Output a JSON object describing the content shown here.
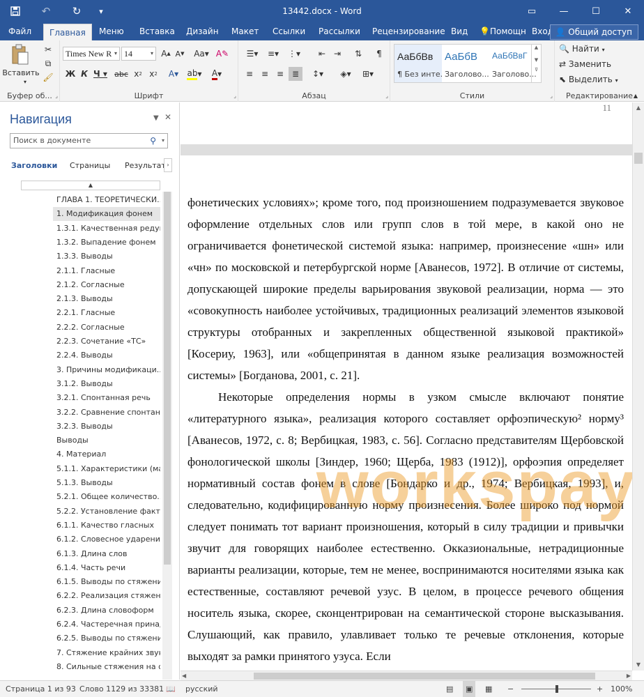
{
  "window": {
    "title": "13442.docx - Word",
    "controls": {
      "restore": "▭",
      "minimize": "—",
      "maximize": "☐",
      "close": "✕"
    }
  },
  "qat": {
    "save": "💾",
    "undo": "↶",
    "redo": "↻",
    "customize": "▾"
  },
  "tabs": [
    {
      "label": "Файл"
    },
    {
      "label": "Главная"
    },
    {
      "label": "Меню"
    },
    {
      "label": "Вставка"
    },
    {
      "label": "Дизайн"
    },
    {
      "label": "Макет"
    },
    {
      "label": "Ссылки"
    },
    {
      "label": "Рассылки"
    },
    {
      "label": "Рецензирование"
    },
    {
      "label": "Вид"
    }
  ],
  "help": "Помощн",
  "signin": "Вход",
  "share": "Общий доступ",
  "ribbon": {
    "clipboard": {
      "label": "Буфер об...",
      "paste": "Вставить"
    },
    "font": {
      "label": "Шрифт",
      "name": "Times New R",
      "size": "14"
    },
    "paragraph": {
      "label": "Абзац"
    },
    "styles": {
      "label": "Стили",
      "items": [
        {
          "sample": "АаБбВв",
          "name": "¶ Без инте..."
        },
        {
          "sample": "АаБбВ",
          "name": "Заголово..."
        },
        {
          "sample": "АаБбВвГ",
          "name": "Заголово..."
        }
      ]
    },
    "editing": {
      "label": "Редактирование",
      "find": "Найти",
      "replace": "Заменить",
      "select": "Выделить"
    }
  },
  "nav": {
    "title": "Навигация",
    "search_placeholder": "Поиск в документе",
    "tabs": {
      "headings": "Заголовки",
      "pages": "Страницы",
      "results": "Результаты"
    },
    "items": [
      {
        "label": "ГЛАВА 1. ТЕОРЕТИЧЕСКИ..."
      },
      {
        "label": "1. Модификация фонем"
      },
      {
        "label": "1.3.1. Качественная редук..."
      },
      {
        "label": "1.3.2. Выпадение фонем"
      },
      {
        "label": "1.3.3. Выводы"
      },
      {
        "label": "2.1.1. Гласные"
      },
      {
        "label": "2.1.2. Согласные"
      },
      {
        "label": "2.1.3. Выводы"
      },
      {
        "label": "2.2.1. Гласные"
      },
      {
        "label": "2.2.2. Согласные"
      },
      {
        "label": "2.2.3. Сочетание «ТС»"
      },
      {
        "label": "2.2.4. Выводы"
      },
      {
        "label": "3. Причины модификаци..."
      },
      {
        "label": "3.1.2. Выводы"
      },
      {
        "label": "3.2.1. Спонтанная речь"
      },
      {
        "label": "3.2.2. Сравнение спонтан..."
      },
      {
        "label": "3.2.3. Выводы"
      },
      {
        "label": "Выводы"
      },
      {
        "label": "4. Материал"
      },
      {
        "label": "5.1.1. Характеристики (ма..."
      },
      {
        "label": "5.1.3. Выводы"
      },
      {
        "label": "5.2.1. Общее количество..."
      },
      {
        "label": "5.2.2. Установление факта..."
      },
      {
        "label": "6.1.1. Качество гласных"
      },
      {
        "label": "6.1.2. Словесное ударение"
      },
      {
        "label": "6.1.3. Длина слов"
      },
      {
        "label": "6.1.4. Часть речи"
      },
      {
        "label": "6.1.5. Выводы по стяжени..."
      },
      {
        "label": "6.2.2. Реализация стяжения"
      },
      {
        "label": "6.2.3. Длина словоформ"
      },
      {
        "label": "6.2.4. Частеречная принад..."
      },
      {
        "label": "6.2.5. Выводы по стяжени..."
      },
      {
        "label": "7. Стяжение крайних звук..."
      },
      {
        "label": "8. Сильные стяжения на с..."
      }
    ]
  },
  "document": {
    "prev_page_number": "11",
    "paragraphs": [
      "фонетических условиях»; кроме того, под произношением подразумевается звуковое оформление отдельных слов или групп слов в той мере, в какой оно не ограничивается фонетической системой языка: например, произнесение «шн» или «чн» по московской и петербургской норме [Аванесов, 1972]. В отличие от системы, допускающей широкие пределы варьирования звуковой реализации, норма — это «совокупность наиболее устойчивых, традиционных реализаций элементов языковой структуры отобранных и закрепленных общественной языковой практикой» [Косериу, 1963], или «общепринятая в данном языке реализация возможностей системы» [Богданова, 2001, с. 21].",
      "Некоторые определения нормы в узком смысле включают понятие «литературного языка», реализация которого составляет орфоэпическую² норму³ [Аванесов, 1972, с. 8; Вербицкая, 1983, с. 56]. Согласно представителям Щербовской фонологической школы [Зиндер, 1960; Щерба, 1983 (1912)], орфоэпия определяет нормативный состав фонем в слове [Бондарко и др., 1974; Вербицкая, 1993], и, следовательно, кодифицированную норму произнесения. Более широко под нормой следует понимать тот вариант произношения, который в силу традиции и привычки звучит для говорящих наиболее естественно. Окказиональные, нетрадиционные варианты реализации, которые, тем не менее, воспринимаются носителями языка как естественные, составляют речевой узус. В целом, в процессе речевого общения носитель языка, скорее, сконцентрирован на семантической стороне высказывания. Слушающий, как правило, улавливает только те речевые отклонения, которые выходят за рамки принятого узуса. Если"
    ],
    "watermark": "workspay.ru"
  },
  "status": {
    "page": "Страница 1 из 93",
    "words": "Слово 1129 из 33381",
    "language": "русский",
    "zoom": "100%"
  },
  "colors": {
    "accent": "#2b579a",
    "ribbon_bg": "#f3f3f3",
    "watermark": "#eb961e"
  }
}
